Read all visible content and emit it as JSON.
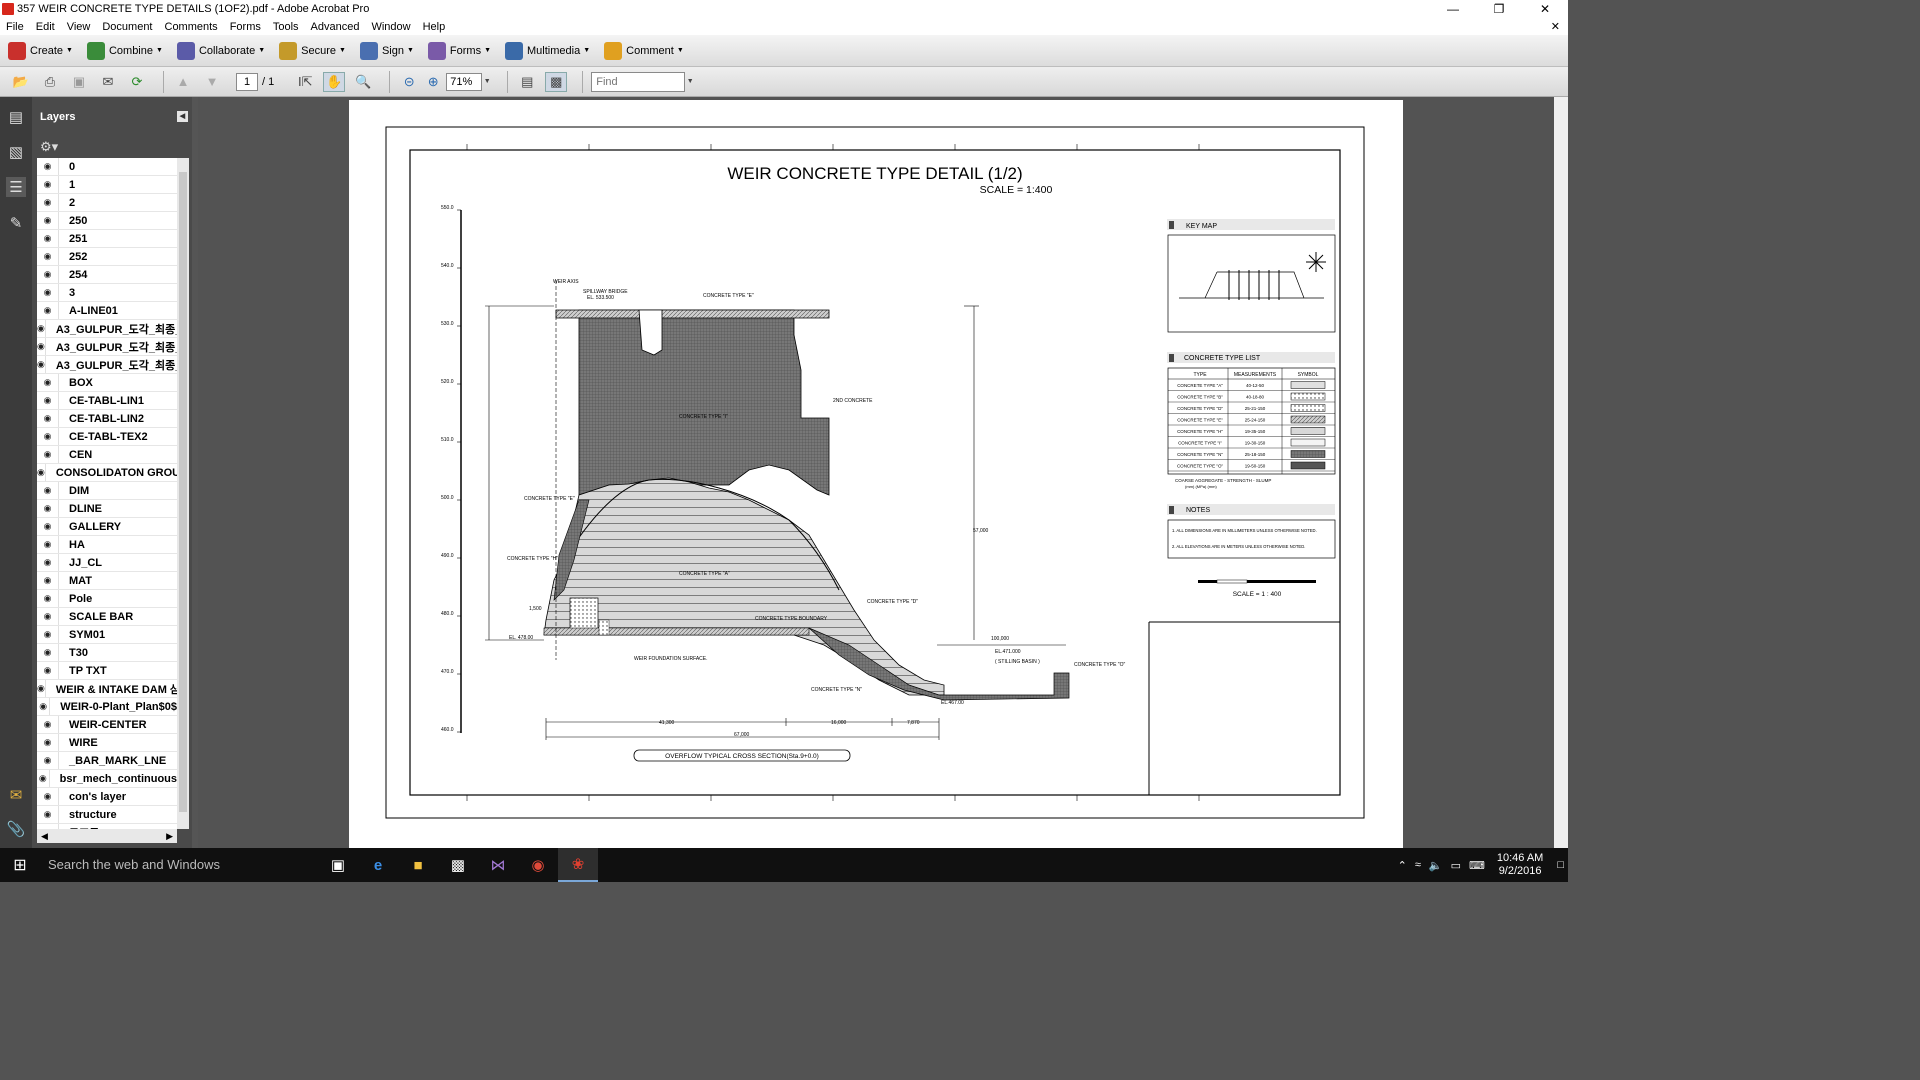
{
  "window": {
    "title": "357 WEIR CONCRETE TYPE DETAILS (1OF2).pdf - Adobe Acrobat Pro"
  },
  "menu": [
    "File",
    "Edit",
    "View",
    "Document",
    "Comments",
    "Forms",
    "Tools",
    "Advanced",
    "Window",
    "Help"
  ],
  "tasks": [
    {
      "label": "Create",
      "color": "#c9302c"
    },
    {
      "label": "Combine",
      "color": "#3a8c3a"
    },
    {
      "label": "Collaborate",
      "color": "#5b5ba8"
    },
    {
      "label": "Secure",
      "color": "#c49a2a"
    },
    {
      "label": "Sign",
      "color": "#4a6fb0"
    },
    {
      "label": "Forms",
      "color": "#7a5aa8"
    },
    {
      "label": "Multimedia",
      "color": "#3a6aa8"
    },
    {
      "label": "Comment",
      "color": "#e0a020"
    }
  ],
  "toolbar": {
    "page_current": "1",
    "page_sep": "/ 1",
    "zoom": "71%",
    "find_placeholder": "Find"
  },
  "layers_panel": {
    "title": "Layers",
    "items": [
      "0",
      "1",
      "2",
      "250",
      "251",
      "252",
      "254",
      "3",
      "A-LINE01",
      "A3_GULPUR_도각_최종_",
      "A3_GULPUR_도각_최종_",
      "A3_GULPUR_도각_최종_",
      "BOX",
      "CE-TABL-LIN1",
      "CE-TABL-LIN2",
      "CE-TABL-TEX2",
      "CEN",
      "CONSOLIDATON GROU",
      "DIM",
      "DLINE",
      "GALLERY",
      "HA",
      "JJ_CL",
      "MAT",
      "Pole",
      "SCALE BAR",
      "SYM01",
      "T30",
      "TP TXT",
      "WEIR & INTAKE DAM 삼",
      "WEIR-0-Plant_Plan$0$",
      "WEIR-CENTER",
      "WIRE",
      "_BAR_MARK_LNE",
      "bsr_mech_continuous",
      "con's layer",
      "structure",
      "구조물"
    ]
  },
  "drawing": {
    "title": "WEIR CONCRETE TYPE DETAIL (1/2)",
    "scale": "SCALE = 1:400",
    "section_label": "OVERFLOW  TYPICAL CROSS SECTION(Sta.9+0.0)",
    "key_map_header": "KEY MAP",
    "concrete_list_header": "CONCRETE TYPE LIST",
    "table_headers": [
      "TYPE",
      "MEASUREMENTS",
      "SYMBOL"
    ],
    "concrete_types": [
      {
        "type": "CONCRETE TYPE \"A\"",
        "meas": "40-12-50"
      },
      {
        "type": "CONCRETE TYPE \"B\"",
        "meas": "40-18-80"
      },
      {
        "type": "CONCRETE TYPE \"D\"",
        "meas": "25-21-150"
      },
      {
        "type": "CONCRETE TYPE \"E\"",
        "meas": "25-24-150"
      },
      {
        "type": "CONCRETE TYPE \"H\"",
        "meas": "19-35-150"
      },
      {
        "type": "CONCRETE TYPE \"I\"",
        "meas": "19-30-150"
      },
      {
        "type": "CONCRETE TYPE \"N\"",
        "meas": "25-18-150"
      },
      {
        "type": "CONCRETE TYPE \"O\"",
        "meas": "19-50-150"
      }
    ],
    "aggregate_note": "COARSE AGGREGATE - STRENGTH - SLUMP",
    "aggregate_units": "(mm)          (MPa)          (mm)",
    "notes_header": "NOTES",
    "notes": [
      "1. ALL DIMENSIONS ARE IN MILLIMETERS UNLESS OTHERWISE NOTED.",
      "2. ALL ELEVATIONS ARE IN METERS UNLESS OTHERWISE NOTED."
    ],
    "scale_bar": "SCALE = 1 : 400",
    "labels": {
      "weir_axis": "WEIR AXIS",
      "spillway_bridge": "SPILLWAY BRIDGE",
      "el_top": "EL. 533.500",
      "ctype_e_top": "CONCRETE TYPE \"E\"",
      "second_conc": "2ND CONCRETE",
      "ctype_i": "CONCRETE TYPE \"I\"",
      "ctype_e_left": "CONCRETE TYPE \"E\"",
      "ctype_h": "CONCRETE TYPE \"H\"",
      "ctype_a": "CONCRETE TYPE \"A\"",
      "ctype_d": "CONCRETE TYPE \"D\"",
      "ctype_n": "CONCRETE TYPE \"N\"",
      "ctype_o": "CONCRETE TYPE \"O\"",
      "boundary": "CONCRETE TYPE BOUNDARY",
      "foundation": "WEIR FOUNDATION SURFACE.",
      "stilling": "( STILLING BASIN )",
      "el_478": "EL. 478.00",
      "el_471": "EL.471.000",
      "el_467": "EL.467.00",
      "d_1500": "1,500",
      "d_57000": "57,000",
      "d_100000": "100,000",
      "d_41300": "41,300",
      "d_16000": "16,000",
      "d_7870": "7,870",
      "d_67000": "67,000"
    },
    "elev_ticks": [
      "550.0",
      "540.0",
      "530.0",
      "520.0",
      "510.0",
      "500.0",
      "490.0",
      "480.0",
      "470.0",
      "460.0"
    ]
  },
  "taskbar": {
    "search": "Search the web and Windows",
    "time": "10:46 AM",
    "date": "9/2/2016"
  }
}
